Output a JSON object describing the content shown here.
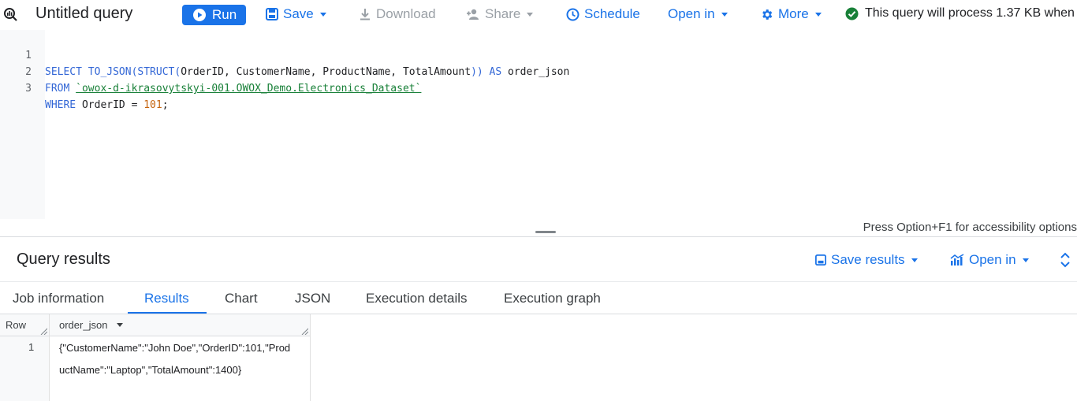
{
  "toolbar": {
    "title": "Untitled query",
    "run_label": "Run",
    "save_label": "Save",
    "download_label": "Download",
    "share_label": "Share",
    "schedule_label": "Schedule",
    "open_in_label": "Open in",
    "more_label": "More",
    "status_text": "This query will process 1.37 KB when ..."
  },
  "editor": {
    "lines": [
      {
        "num": "1",
        "kw1": "SELECT",
        "fn": " TO_JSON(STRUCT(",
        "rest": "OrderID, CustomerName, ProductName, TotalAmount",
        "close": "))",
        "kw2": " AS",
        "alias": " order_json"
      },
      {
        "num": "2",
        "kw1": "FROM",
        "table": "`owox-d-ikrasovytskyi-001.OWOX_Demo.Electronics_Dataset`"
      },
      {
        "num": "3",
        "kw1": "WHERE",
        "ident": " OrderID = ",
        "num_val": "101",
        "end": ";"
      }
    ],
    "accessibility_hint": "Press Option+F1 for accessibility options"
  },
  "results": {
    "title": "Query results",
    "save_results_label": "Save results",
    "open_in_label": "Open in",
    "tabs": [
      "Job information",
      "Results",
      "Chart",
      "JSON",
      "Execution details",
      "Execution graph"
    ],
    "active_tab": "Results",
    "columns": [
      "Row",
      "order_json"
    ],
    "rows": [
      {
        "row": "1",
        "order_json": "{\"CustomerName\":\"John Doe\",\"OrderID\":101,\"ProductName\":\"Laptop\",\"TotalAmount\":1400}"
      }
    ]
  },
  "colors": {
    "accent": "#1a73e8",
    "success": "#188038"
  }
}
